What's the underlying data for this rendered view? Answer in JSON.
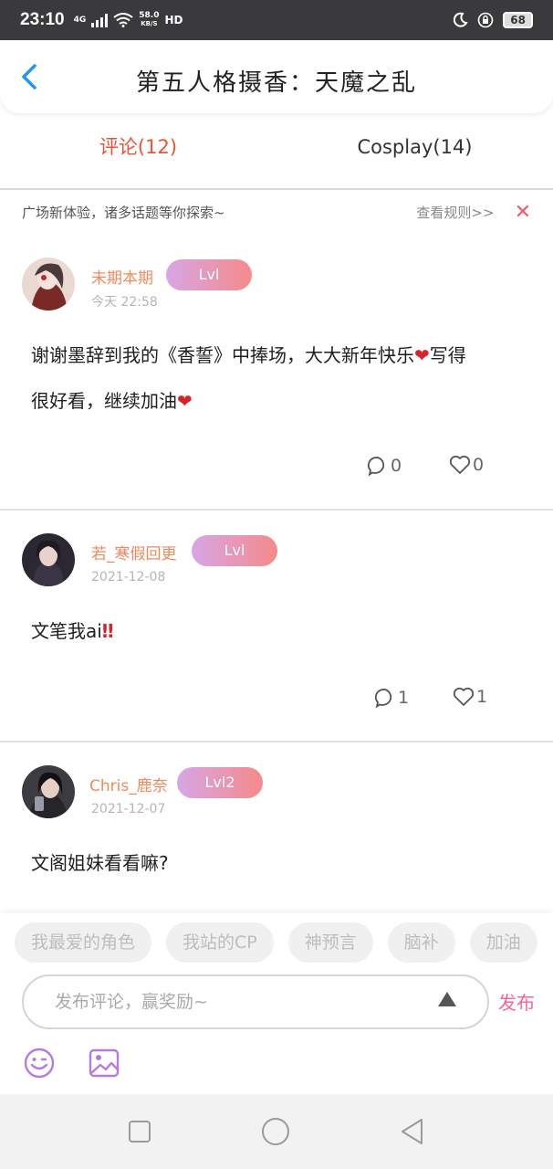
{
  "status_bar": {
    "time": "23:10",
    "network_type": "4G",
    "net_speed": "58.0",
    "net_speed_unit": "KB/S",
    "hd": "HD",
    "battery": "68"
  },
  "header": {
    "title": "第五人格摄香：天魔之乱",
    "back_icon": "chevron-left-icon"
  },
  "tabs": [
    {
      "label": "评论(12)",
      "active": true
    },
    {
      "label": "Cosplay(14)",
      "active": false
    }
  ],
  "notice": {
    "text": "广场新体验，诸多话题等你探索~",
    "rule_link": "查看规则>>",
    "close_icon": "close-icon"
  },
  "comments": [
    {
      "username": "未期本期",
      "level": "Lvl",
      "time": "今天 22:58",
      "text_line1": "谢谢墨辞到我的《香誓》中捧场，大大新年快乐",
      "text_line1_tail": "写得",
      "text_line2": "很好看，继续加油",
      "emoji": "❤",
      "reply_count": "0",
      "like_count": "0"
    },
    {
      "username": "若_寒假回更",
      "level": "Lvl",
      "time": "2021-12-08",
      "text": "文笔我ai",
      "emoji": "‼",
      "reply_count": "1",
      "like_count": "1"
    },
    {
      "username": "Chris_鹿奈",
      "level": "Lvl2",
      "time": "2021-12-07",
      "text": "文阁姐妹看看嘛?"
    }
  ],
  "composer": {
    "topics": [
      "我最爱的角色",
      "我站的CP",
      "神预言",
      "脑补",
      "加油"
    ],
    "placeholder": "发布评论，赢奖励~",
    "publish_label": "发布",
    "emoji_icon": "smiley-icon",
    "image_icon": "image-icon"
  },
  "colors": {
    "accent": "#e8543a",
    "username": "#f08a5d",
    "publish": "#f0679a",
    "level_gradient_start": "#d7a6e6",
    "level_gradient_end": "#f58a8a"
  }
}
